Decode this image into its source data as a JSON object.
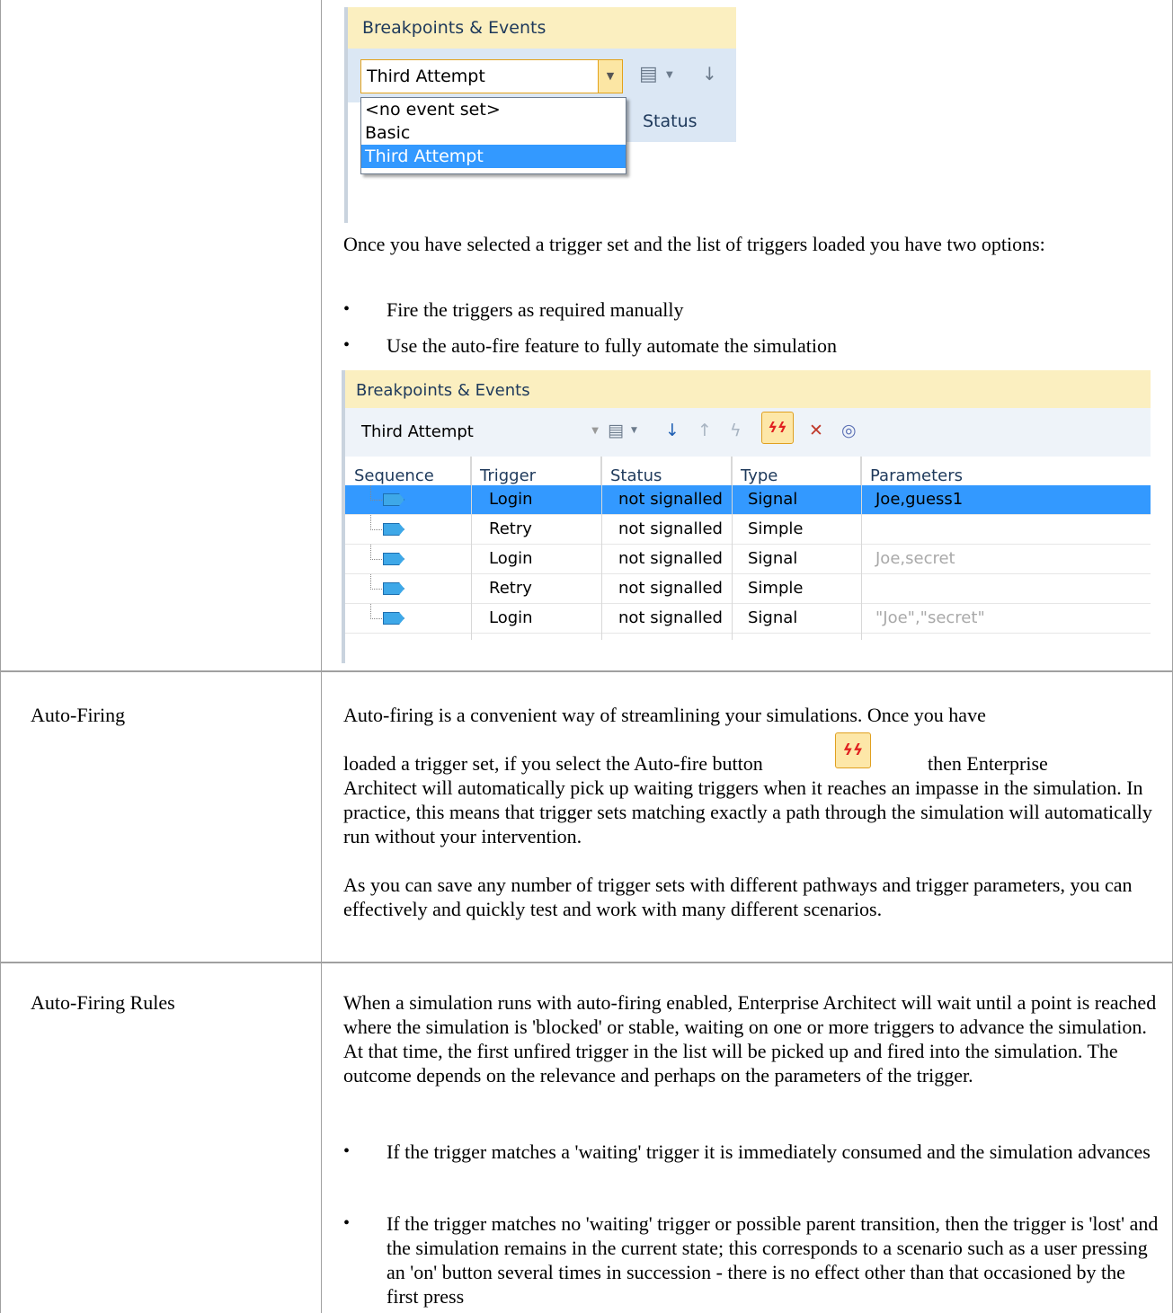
{
  "shot1": {
    "panel_title": "Breakpoints & Events",
    "combo_value": "Third Attempt",
    "column_header": "Status",
    "dropdown_options": [
      "<no event set>",
      "Basic",
      "Third Attempt"
    ],
    "selected_option": "Third Attempt"
  },
  "intro": {
    "text": "Once you have selected a trigger set and the list of triggers loaded you have two options:",
    "bullets": [
      "Fire the triggers as required manually",
      "Use the auto-fire feature to fully automate the simulation"
    ]
  },
  "shot2": {
    "panel_title": "Breakpoints & Events",
    "combo_value": "Third Attempt",
    "columns": [
      "Sequence",
      "Trigger",
      "Status",
      "Type",
      "Parameters"
    ],
    "rows": [
      {
        "trigger": "Login",
        "status": "not signalled",
        "type": "Signal",
        "parameters": "Joe,guess1",
        "selected": true
      },
      {
        "trigger": "Retry",
        "status": "not signalled",
        "type": "Simple",
        "parameters": ""
      },
      {
        "trigger": "Login",
        "status": "not signalled",
        "type": "Signal",
        "parameters": "Joe,secret"
      },
      {
        "trigger": "Retry",
        "status": "not signalled",
        "type": "Simple",
        "parameters": ""
      },
      {
        "trigger": "Login",
        "status": "not signalled",
        "type": "Signal",
        "parameters": "\"Joe\",\"secret\""
      }
    ],
    "auto_fire_glyph": "ϟϟ",
    "selection_color": "#3399ff",
    "header_color": "#fbefc0"
  },
  "autofiring": {
    "label": "Auto-Firing",
    "line1": "Auto-firing is a convenient way of streamlining your simulations. Once you have",
    "line2a": "loaded a trigger set, if you select the Auto-fire button",
    "line2b": "then Enterprise",
    "rest": "Architect will automatically pick up waiting triggers when it reaches an impasse in the simulation. In practice, this means that trigger sets matching exactly a path through the simulation will automatically run without your intervention.",
    "para2": "As you can save any number of trigger sets with different pathways and trigger parameters, you can effectively and quickly test and work with many different scenarios."
  },
  "rules": {
    "label": "Auto-Firing Rules",
    "para": "When a simulation runs with auto-firing enabled, Enterprise Architect will wait until a point is reached where the simulation is 'blocked' or stable, waiting on one or more triggers to advance the simulation. At that time, the first unfired trigger in the list will be picked up and fired into the simulation. The outcome depends on the relevance and perhaps on the parameters of the trigger.",
    "bullets": [
      "If the trigger matches a 'waiting' trigger it is immediately consumed and the simulation advances",
      "If the trigger matches no 'waiting' trigger or possible parent transition, then the trigger is 'lost' and the simulation remains in the current state; this corresponds to a scenario such as a user pressing an 'on' button several times in succession - there is no effect other than that occasioned by the first press"
    ]
  }
}
